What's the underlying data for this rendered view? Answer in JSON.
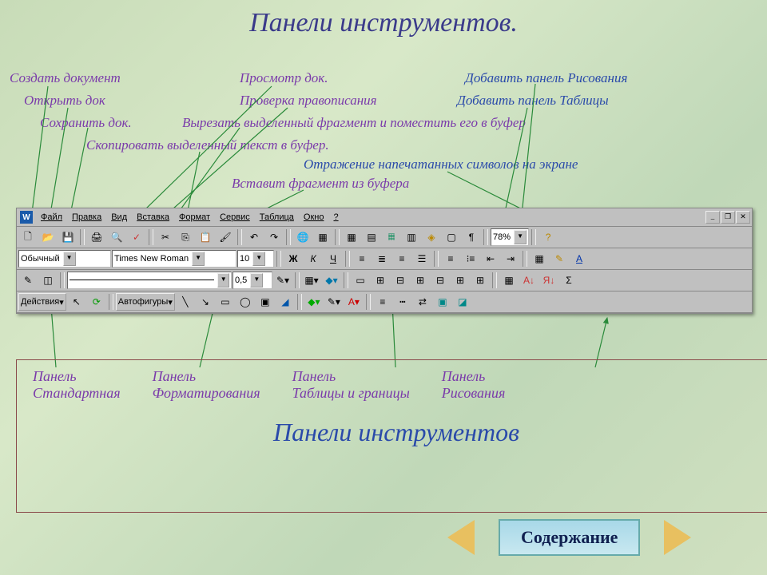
{
  "title": "Панели инструментов.",
  "annotations": {
    "a1": "Создать документ",
    "a2": "Просмотр док.",
    "a3": "Добавить панель Рисования",
    "a4": "Открыть док",
    "a5": "Проверка правописания",
    "a6": "Добавить панель Таблицы",
    "a7": "Сохранить док.",
    "a8": "Вырезать выделенный фрагмент и поместить его в буфер",
    "a9": "Скопировать выделенный текст в буфер.",
    "a10": "Отражение напечатанных символов на экране",
    "a11": "Вставит фрагмент из буфера"
  },
  "menu": {
    "file": "Файл",
    "edit": "Правка",
    "view": "Вид",
    "insert": "Вставка",
    "format": "Формат",
    "tools": "Сервис",
    "table": "Таблица",
    "window": "Окно",
    "help": "?"
  },
  "standard": {
    "zoom": "78%"
  },
  "format": {
    "style": "Обычный",
    "font": "Times New Roman",
    "size": "10",
    "bold": "Ж",
    "italic": "К",
    "under": "Ч"
  },
  "tables": {
    "weight": "0,5"
  },
  "drawing": {
    "actions": "Действия",
    "autoshapes": "Автофигуры"
  },
  "legend": {
    "c1a": "Панель",
    "c1b": "Стандартная",
    "c2a": "Панель",
    "c2b": "Форматирования",
    "c3a": "Панель",
    "c3b": "Таблицы и границы",
    "c4a": "Панель",
    "c4b": "Рисования",
    "big": "Панели инструментов"
  },
  "nav": {
    "contents": "Содержание"
  }
}
